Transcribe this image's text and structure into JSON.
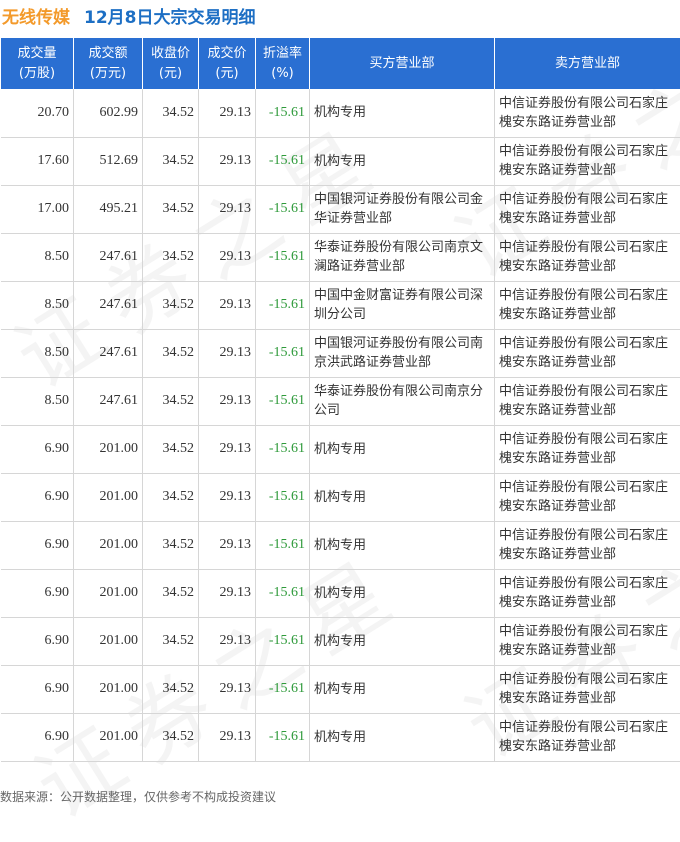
{
  "header": {
    "stock_name": "无线传媒",
    "description": "12月8日大宗交易明细"
  },
  "watermark_text": "证券之星",
  "table": {
    "columns": [
      {
        "line1": "成交量",
        "line2": "(万股)"
      },
      {
        "line1": "成交额",
        "line2": "(万元)"
      },
      {
        "line1": "收盘价",
        "line2": "(元)"
      },
      {
        "line1": "成交价",
        "line2": "(元)"
      },
      {
        "line1": "折溢率",
        "line2": "(%)"
      },
      {
        "line1": "买方营业部",
        "line2": ""
      },
      {
        "line1": "卖方营业部",
        "line2": ""
      }
    ],
    "rows": [
      {
        "volume": "20.70",
        "amount": "602.99",
        "close": "34.52",
        "price": "29.13",
        "premium": "-15.61",
        "buyer": "机构专用",
        "seller": "中信证券股份有限公司石家庄槐安东路证券营业部"
      },
      {
        "volume": "17.60",
        "amount": "512.69",
        "close": "34.52",
        "price": "29.13",
        "premium": "-15.61",
        "buyer": "机构专用",
        "seller": "中信证券股份有限公司石家庄槐安东路证券营业部"
      },
      {
        "volume": "17.00",
        "amount": "495.21",
        "close": "34.52",
        "price": "29.13",
        "premium": "-15.61",
        "buyer": "中国银河证券股份有限公司金华证券营业部",
        "seller": "中信证券股份有限公司石家庄槐安东路证券营业部"
      },
      {
        "volume": "8.50",
        "amount": "247.61",
        "close": "34.52",
        "price": "29.13",
        "premium": "-15.61",
        "buyer": "华泰证券股份有限公司南京文澜路证券营业部",
        "seller": "中信证券股份有限公司石家庄槐安东路证券营业部"
      },
      {
        "volume": "8.50",
        "amount": "247.61",
        "close": "34.52",
        "price": "29.13",
        "premium": "-15.61",
        "buyer": "中国中金财富证券有限公司深圳分公司",
        "seller": "中信证券股份有限公司石家庄槐安东路证券营业部"
      },
      {
        "volume": "8.50",
        "amount": "247.61",
        "close": "34.52",
        "price": "29.13",
        "premium": "-15.61",
        "buyer": "中国银河证券股份有限公司南京洪武路证券营业部",
        "seller": "中信证券股份有限公司石家庄槐安东路证券营业部"
      },
      {
        "volume": "8.50",
        "amount": "247.61",
        "close": "34.52",
        "price": "29.13",
        "premium": "-15.61",
        "buyer": "华泰证券股份有限公司南京分公司",
        "seller": "中信证券股份有限公司石家庄槐安东路证券营业部"
      },
      {
        "volume": "6.90",
        "amount": "201.00",
        "close": "34.52",
        "price": "29.13",
        "premium": "-15.61",
        "buyer": "机构专用",
        "seller": "中信证券股份有限公司石家庄槐安东路证券营业部"
      },
      {
        "volume": "6.90",
        "amount": "201.00",
        "close": "34.52",
        "price": "29.13",
        "premium": "-15.61",
        "buyer": "机构专用",
        "seller": "中信证券股份有限公司石家庄槐安东路证券营业部"
      },
      {
        "volume": "6.90",
        "amount": "201.00",
        "close": "34.52",
        "price": "29.13",
        "premium": "-15.61",
        "buyer": "机构专用",
        "seller": "中信证券股份有限公司石家庄槐安东路证券营业部"
      },
      {
        "volume": "6.90",
        "amount": "201.00",
        "close": "34.52",
        "price": "29.13",
        "premium": "-15.61",
        "buyer": "机构专用",
        "seller": "中信证券股份有限公司石家庄槐安东路证券营业部"
      },
      {
        "volume": "6.90",
        "amount": "201.00",
        "close": "34.52",
        "price": "29.13",
        "premium": "-15.61",
        "buyer": "机构专用",
        "seller": "中信证券股份有限公司石家庄槐安东路证券营业部"
      },
      {
        "volume": "6.90",
        "amount": "201.00",
        "close": "34.52",
        "price": "29.13",
        "premium": "-15.61",
        "buyer": "机构专用",
        "seller": "中信证券股份有限公司石家庄槐安东路证券营业部"
      },
      {
        "volume": "6.90",
        "amount": "201.00",
        "close": "34.52",
        "price": "29.13",
        "premium": "-15.61",
        "buyer": "机构专用",
        "seller": "中信证券股份有限公司石家庄槐安东路证券营业部"
      }
    ]
  },
  "footer": {
    "source": "数据来源：公开数据整理，仅供参考不构成投资建议"
  },
  "colors": {
    "header_bg": "#2a6fd2",
    "stock_name": "#f39a2b",
    "title": "#1d6fc4",
    "negative": "#2e9a3a"
  }
}
